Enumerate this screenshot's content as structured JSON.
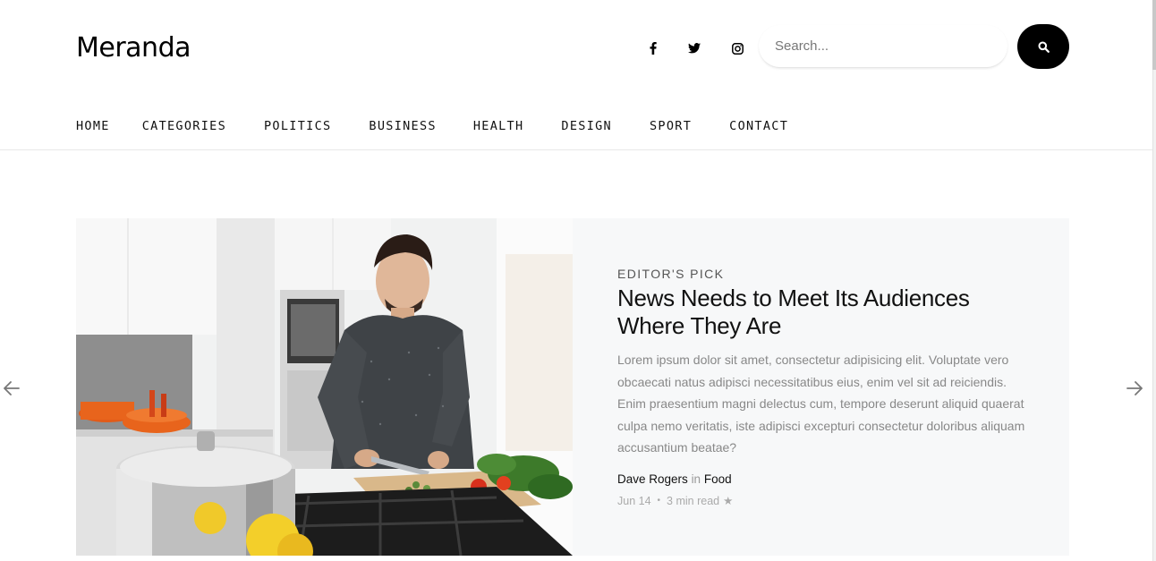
{
  "site": {
    "logo": "Meranda"
  },
  "social": {
    "icons": [
      "facebook-icon",
      "twitter-icon",
      "instagram-icon"
    ]
  },
  "search": {
    "placeholder": "Search...",
    "value": "",
    "button_icon": "search-icon"
  },
  "nav": {
    "items": [
      "HOME",
      "CATEGORIES",
      "POLITICS",
      "BUSINESS",
      "HEALTH",
      "DESIGN",
      "SPORT",
      "CONTACT"
    ]
  },
  "hero": {
    "kicker": "EDITOR'S PICK",
    "title": "News Needs to Meet Its Audiences Where They Are",
    "excerpt": "Lorem ipsum dolor sit amet, consectetur adipisicing elit. Voluptate vero obcaecati natus adipisci necessitatibus eius, enim vel sit ad reiciendis. Enim praesentium magni delectus cum, tempore deserunt aliquid quaerat culpa nemo veritatis, iste adipisci excepturi consectetur doloribus aliquam accusantium beatae?",
    "author": "Dave Rogers",
    "in_word": "in",
    "category": "Food",
    "date": "Jun 14",
    "read_time": "3 min read"
  },
  "carousel": {
    "prev_icon": "arrow-left-icon",
    "next_icon": "arrow-right-icon"
  },
  "colors": {
    "accent": "#000000",
    "card_bg": "#f7f8f9",
    "muted_text": "#888888"
  }
}
